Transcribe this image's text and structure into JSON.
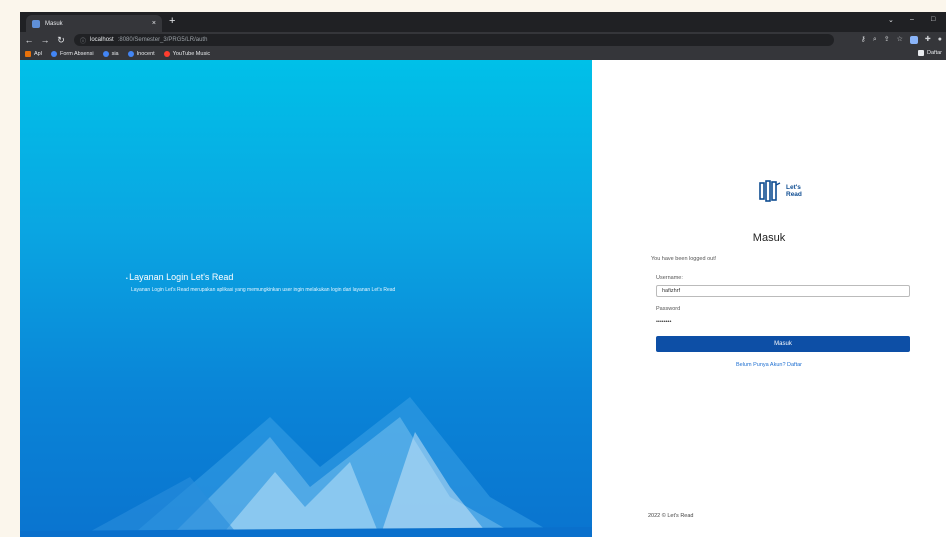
{
  "browser": {
    "tab_title": "Masuk",
    "tab_close": "×",
    "new_tab": "+",
    "win_min": "–",
    "win_chev": "⌄",
    "win_max": "□",
    "url_host": "localhost",
    "url_path": ":8080/Semester_3/PRG5/LR/auth",
    "bookmarks": [
      "Apl",
      "Form Absensi",
      "sia",
      "Inocent",
      "YouTube Music"
    ],
    "bookmark_right": "Daftar"
  },
  "hero": {
    "title": "Layanan Login Let's Read",
    "subtitle": "Layanan Login Let's Read merupakan aplikasi yang memungkinkan user ingin melakukan login dari layanan Let's Read"
  },
  "login": {
    "logo_line1": "Let's",
    "logo_line2": "Read",
    "heading": "Masuk",
    "alert": "You have been logged out!",
    "username_label": "Username:",
    "username_value": "hafizhrf",
    "password_label": "Password",
    "password_value": "••••••••",
    "submit_label": "Masuk",
    "register_text": "Belum Punya Akun? Daftar",
    "footer": "2022 © Let's Read"
  },
  "colors": {
    "accent": "#0d4fa6",
    "hero_top": "#00c0e8",
    "hero_bottom": "#0a74cf"
  }
}
